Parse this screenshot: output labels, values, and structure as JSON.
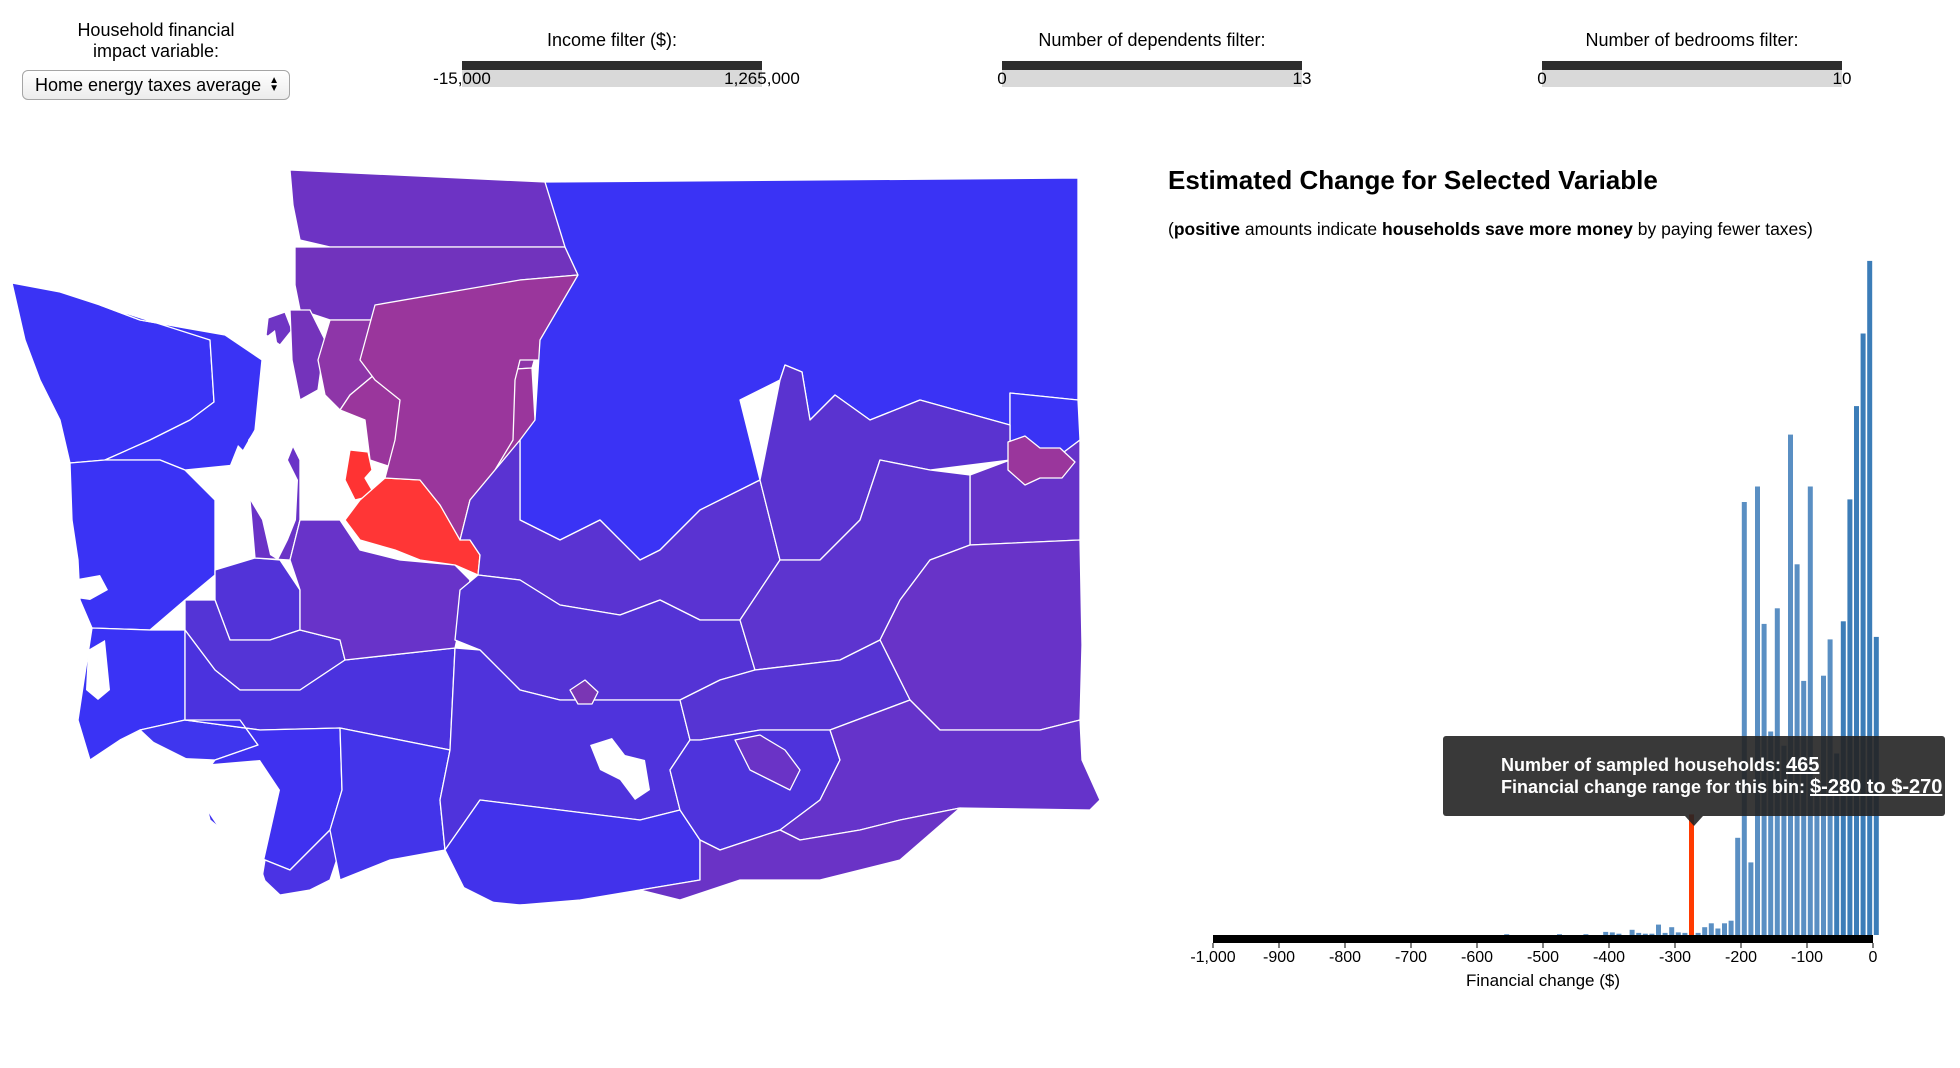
{
  "controls": {
    "variable": {
      "label_line1": "Household financial",
      "label_line2": "impact variable:",
      "selected": "Home energy taxes average"
    },
    "income": {
      "label": "Income filter ($):",
      "min": "-15,000",
      "max": "1,265,000"
    },
    "dependents": {
      "label": "Number of dependents filter:",
      "min": "0",
      "max": "13"
    },
    "bedrooms": {
      "label": "Number of bedrooms filter:",
      "min": "0",
      "max": "10"
    }
  },
  "map": {
    "counties": [
      {
        "name": "clallam",
        "color": "#3a33f5"
      },
      {
        "name": "jefferson",
        "color": "#3a33f5"
      },
      {
        "name": "grays-harbor",
        "color": "#3a33f5"
      },
      {
        "name": "pacific",
        "color": "#3a33f5"
      },
      {
        "name": "wahkiakum",
        "color": "#3f36ee"
      },
      {
        "name": "mason",
        "color": "#5233d8"
      },
      {
        "name": "thurston",
        "color": "#5434d6"
      },
      {
        "name": "lewis",
        "color": "#4b32de"
      },
      {
        "name": "cowlitz",
        "color": "#3f31f0"
      },
      {
        "name": "clark",
        "color": "#4b33e4"
      },
      {
        "name": "skamania",
        "color": "#4334ea"
      },
      {
        "name": "san-juan",
        "color": "#6f35c4"
      },
      {
        "name": "whatcom",
        "color": "#6d33c4"
      },
      {
        "name": "skagit",
        "color": "#7133bd"
      },
      {
        "name": "snohomish",
        "color": "#8e36a8"
      },
      {
        "name": "king-east",
        "color": "#9a369c"
      },
      {
        "name": "king-seattle",
        "color": "#ff3333"
      },
      {
        "name": "pierce",
        "color": "#6833c9"
      },
      {
        "name": "kitsap",
        "color": "#6a33c7"
      },
      {
        "name": "island",
        "color": "#7433bb"
      },
      {
        "name": "chelan",
        "color": "#9a369c"
      },
      {
        "name": "kittitas",
        "color": "#ff3636"
      },
      {
        "name": "okanogan",
        "color": "#3a33f5"
      },
      {
        "name": "douglas",
        "color": "#5a33d2"
      },
      {
        "name": "ferry-stevens-pend-oreille",
        "color": "#3a33f5"
      },
      {
        "name": "grant",
        "color": "#5433d5"
      },
      {
        "name": "lincoln",
        "color": "#5a33d0"
      },
      {
        "name": "spokane",
        "color": "#6633c9"
      },
      {
        "name": "spokane-city",
        "color": "#9a369c"
      },
      {
        "name": "yakima",
        "color": "#4f33dc"
      },
      {
        "name": "klickitat",
        "color": "#4232eb"
      },
      {
        "name": "benton",
        "color": "#4e33dc"
      },
      {
        "name": "franklin",
        "color": "#5634d3"
      },
      {
        "name": "adams",
        "color": "#5d34cf"
      },
      {
        "name": "whitman",
        "color": "#6833c8"
      },
      {
        "name": "walla-walla",
        "color": "#6533ca"
      },
      {
        "name": "columbia-garfield-asotin",
        "color": "#6a33c6"
      },
      {
        "name": "yakima-city",
        "color": "#7a36b4"
      },
      {
        "name": "tri-cities",
        "color": "#6a33c6"
      }
    ]
  },
  "chart": {
    "title": "Estimated Change for Selected Variable",
    "subtitle_parts": [
      "(",
      "positive",
      " amounts indicate ",
      "households save more money",
      " by paying fewer taxes)"
    ],
    "xlabel": "Financial change ($)"
  },
  "chart_data": {
    "type": "bar",
    "title": "Estimated Change for Selected Variable",
    "xlabel": "Financial change ($)",
    "ylabel": "",
    "xlim": [
      -1000,
      0
    ],
    "bin_width": 10,
    "x_ticks": [
      -1000,
      -900,
      -800,
      -700,
      -600,
      -500,
      -400,
      -300,
      -200,
      -100,
      0
    ],
    "x_tick_labels": [
      "-1,000",
      "-900",
      "-800",
      "-700",
      "-600",
      "-500",
      "-400",
      "-300",
      "-200",
      "-100",
      "0"
    ],
    "bins": [
      {
        "x0": -560,
        "count": 3
      },
      {
        "x0": -480,
        "count": 3
      },
      {
        "x0": -440,
        "count": 3
      },
      {
        "x0": -410,
        "count": 12
      },
      {
        "x0": -400,
        "count": 10
      },
      {
        "x0": -390,
        "count": 5
      },
      {
        "x0": -370,
        "count": 20
      },
      {
        "x0": -360,
        "count": 8
      },
      {
        "x0": -350,
        "count": 5
      },
      {
        "x0": -340,
        "count": 5
      },
      {
        "x0": -330,
        "count": 40
      },
      {
        "x0": -320,
        "count": 8
      },
      {
        "x0": -310,
        "count": 30
      },
      {
        "x0": -300,
        "count": 10
      },
      {
        "x0": -290,
        "count": 8
      },
      {
        "x0": -280,
        "count": 465
      },
      {
        "x0": -270,
        "count": 8
      },
      {
        "x0": -260,
        "count": 30
      },
      {
        "x0": -250,
        "count": 45
      },
      {
        "x0": -240,
        "count": 25
      },
      {
        "x0": -230,
        "count": 45
      },
      {
        "x0": -220,
        "count": 55
      },
      {
        "x0": -210,
        "count": 375
      },
      {
        "x0": -200,
        "count": 1670
      },
      {
        "x0": -190,
        "count": 280
      },
      {
        "x0": -180,
        "count": 1730
      },
      {
        "x0": -170,
        "count": 1200
      },
      {
        "x0": -160,
        "count": 785
      },
      {
        "x0": -150,
        "count": 1260
      },
      {
        "x0": -140,
        "count": 730
      },
      {
        "x0": -130,
        "count": 1930
      },
      {
        "x0": -120,
        "count": 1430
      },
      {
        "x0": -110,
        "count": 980
      },
      {
        "x0": -100,
        "count": 1730
      },
      {
        "x0": -90,
        "count": 600
      },
      {
        "x0": -80,
        "count": 1000
      },
      {
        "x0": -70,
        "count": 1140
      },
      {
        "x0": -60,
        "count": 700
      },
      {
        "x0": -50,
        "count": 1210
      },
      {
        "x0": -40,
        "count": 1680
      },
      {
        "x0": -30,
        "count": 2040
      },
      {
        "x0": -20,
        "count": 2320
      },
      {
        "x0": -10,
        "count": 2600
      },
      {
        "x0": 0,
        "count": 1150
      }
    ],
    "highlight_bin": -280,
    "ylim": [
      0,
      2700
    ],
    "colors": {
      "bar": "#5a8fc3",
      "bar_dark": "#3c7db8",
      "highlight": "#ff3a00",
      "axis": "#000000"
    }
  },
  "tooltip": {
    "count_label": "Number of sampled households: ",
    "count_value": "465",
    "range_label": "Financial change range for this bin: ",
    "range_value": "$-280 to $-270"
  }
}
